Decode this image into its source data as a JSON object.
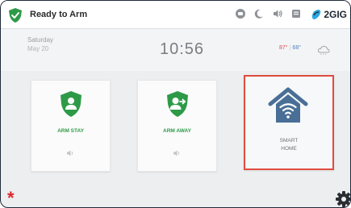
{
  "status": {
    "text": "Ready to Arm",
    "ok_color": "#2e9a48",
    "icons": [
      "battery-icon",
      "moon-icon",
      "volume-icon",
      "message-icon"
    ]
  },
  "brand": {
    "name": "2GIG",
    "accent": "#2aa7e0"
  },
  "info": {
    "day": "Saturday",
    "date": "May 20",
    "time": "10:56",
    "temp_high": "87°",
    "temp_separator": "|",
    "temp_low": "68°",
    "weather_icon": "cloud-icon"
  },
  "tiles": {
    "arm_stay": {
      "label": "ARM STAY",
      "icon": "shield-person-icon",
      "color": "#2e9a48"
    },
    "arm_away": {
      "label": "ARM AWAY",
      "icon": "shield-person-arrow-icon",
      "color": "#2e9a48"
    },
    "smart_home": {
      "line1": "SMART",
      "line2": "HOME",
      "icon": "house-wifi-icon",
      "highlight_color": "#e04a3f"
    }
  },
  "footer": {
    "emergency_symbol": "*",
    "settings_icon": "gear-icon"
  }
}
